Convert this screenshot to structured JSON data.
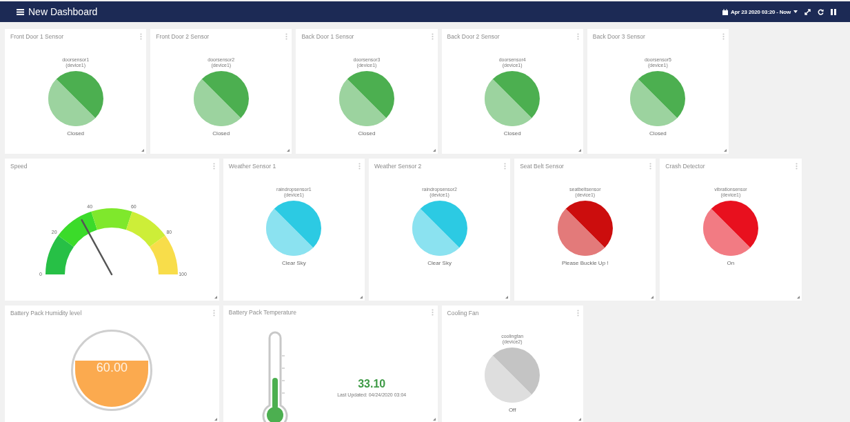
{
  "header": {
    "title": "New Dashboard",
    "time_range": "Apr 23 2020 03:20 - Now"
  },
  "cards": [
    {
      "kind": "status",
      "title": "Front Door 1 Sensor",
      "device": "doorsensor1",
      "group": "(device1)",
      "value": "Closed",
      "color": "#4caf50"
    },
    {
      "kind": "status",
      "title": "Front Door 2 Sensor",
      "device": "doorsensor2",
      "group": "(device1)",
      "value": "Closed",
      "color": "#4caf50"
    },
    {
      "kind": "status",
      "title": "Back Door 1 Sensor",
      "device": "doorsensor3",
      "group": "(device1)",
      "value": "Closed",
      "color": "#4caf50"
    },
    {
      "kind": "status",
      "title": "Back Door 2 Sensor",
      "device": "doorsensor4",
      "group": "(device1)",
      "value": "Closed",
      "color": "#4caf50"
    },
    {
      "kind": "status",
      "title": "Back Door 3 Sensor",
      "device": "doorsensor5",
      "group": "(device1)",
      "value": "Closed",
      "color": "#4caf50"
    },
    {
      "kind": "gauge",
      "title": "Speed",
      "level": 0.34,
      "ticks": [
        "0",
        "20",
        "40",
        "60",
        "80",
        "100"
      ]
    },
    {
      "kind": "status",
      "title": "Weather Sensor 1",
      "device": "raindropsensor1",
      "group": "(device1)",
      "value": "Clear Sky",
      "color": "#2ccae3"
    },
    {
      "kind": "status",
      "title": "Weather Sensor 2",
      "device": "raindropsensor2",
      "group": "(device1)",
      "value": "Clear Sky",
      "color": "#2ccae3"
    },
    {
      "kind": "status",
      "title": "Seat Belt Sensor",
      "device": "seatbeltsensor",
      "group": "(device1)",
      "value": "Please Buckle Up !",
      "color": "#cc0d0d"
    },
    {
      "kind": "status",
      "title": "Crash Detector",
      "device": "vibrationsensor",
      "group": "(device1)",
      "value": "On",
      "color": "#e8101e"
    },
    {
      "kind": "tank",
      "title": "Battery Pack Humidity level",
      "level": 0.6,
      "value": "60.00"
    },
    {
      "kind": "thermometer",
      "title": "Battery Pack Temperature",
      "level": 0.42,
      "value": "33.10",
      "updated": "Last Updated: 04/24/2020 03:04"
    },
    {
      "kind": "status",
      "title": "Cooling Fan",
      "device": "coolingfan",
      "group": "(device2)",
      "value": "Off",
      "color": "#c4c4c4"
    }
  ]
}
